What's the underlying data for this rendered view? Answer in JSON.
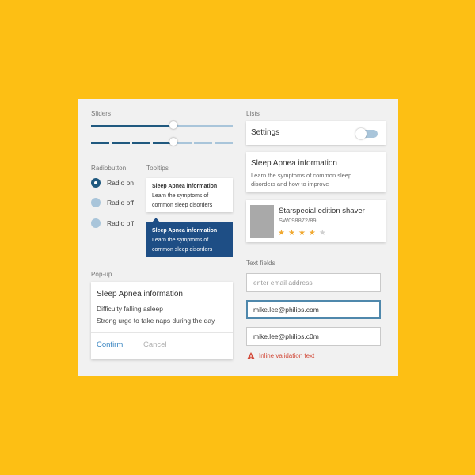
{
  "colors": {
    "background": "#FDBF14",
    "panel": "#F1F1F1",
    "accent_dark": "#20597F",
    "accent_light": "#A9C5DA",
    "tooltip_dark": "#1E4E85",
    "star": "#F0A830",
    "error": "#D24C3C"
  },
  "sliders": {
    "label": "Sliders",
    "continuous_value": 0.58,
    "stepped_value": 0.58
  },
  "radiobutton": {
    "label": "Radiobutton",
    "options": [
      {
        "label": "Radio on",
        "selected": true
      },
      {
        "label": "Radio off",
        "selected": false
      },
      {
        "label": "Radio off",
        "selected": false
      }
    ]
  },
  "tooltips": {
    "label": "Tooltips",
    "light": {
      "title": "Sleep Apnea information",
      "body": "Learn the symptoms of common sleep disorders"
    },
    "dark": {
      "title": "Sleep Apnea information",
      "body": "Learn the symptoms of common sleep disorders"
    }
  },
  "popup": {
    "label": "Pop-up",
    "title": "Sleep Apnea information",
    "line1": "Difficulty falling asleep",
    "line2": "Strong urge to take naps during the day",
    "confirm": "Confirm",
    "cancel": "Cancel"
  },
  "lists": {
    "label": "Lists",
    "settings": {
      "label": "Settings",
      "toggle_on": false
    },
    "info": {
      "title": "Sleep Apnea information",
      "body": "Learn the symptoms of common sleep disorders and how to improve"
    },
    "product": {
      "title": "Starspecial edition shaver",
      "sku": "SW098872/89",
      "rating": 4,
      "max_rating": 5
    }
  },
  "text_fields": {
    "label": "Text fields",
    "empty_placeholder": "enter email address",
    "focused_value": "mike.lee@philips.com",
    "error_value": "mike.lee@philips.c0m",
    "validation": "Inline validation text"
  }
}
